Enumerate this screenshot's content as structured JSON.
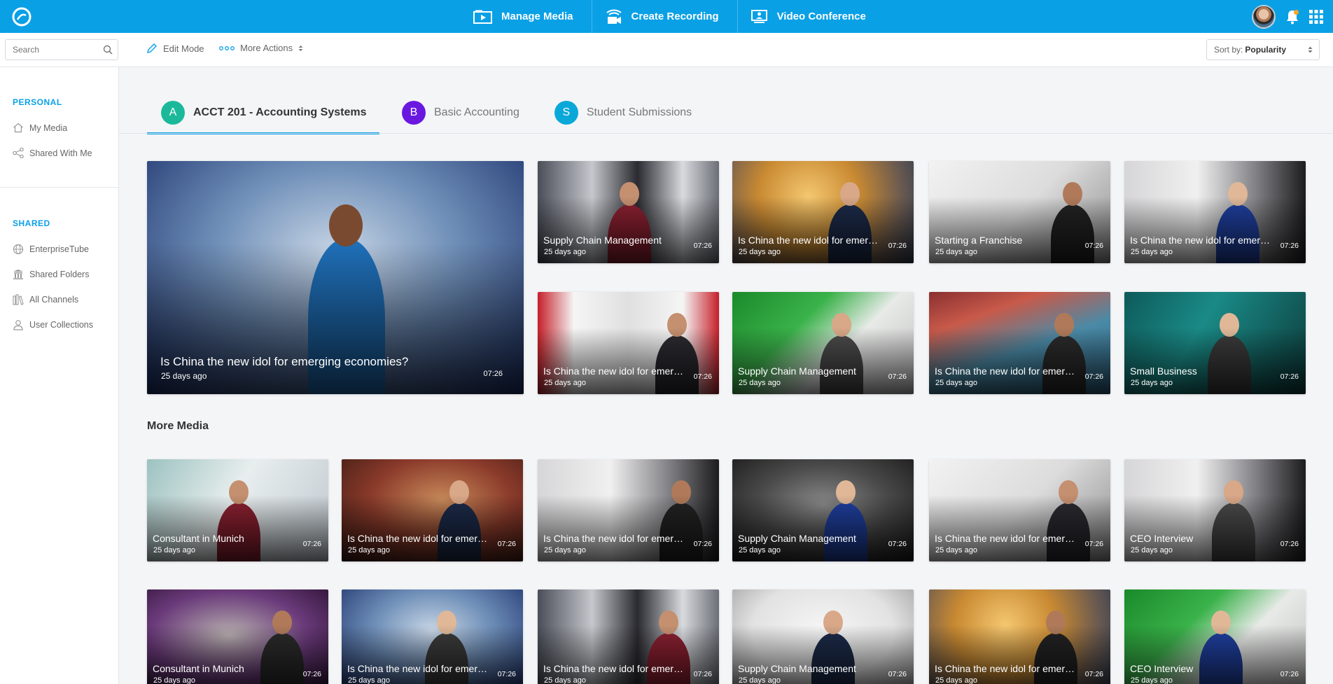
{
  "topbar": {
    "nav": [
      {
        "label": "Manage Media",
        "icon": "manage-media-icon"
      },
      {
        "label": "Create Recording",
        "icon": "create-recording-icon"
      },
      {
        "label": "Video Conference",
        "icon": "video-conference-icon"
      }
    ]
  },
  "toolbar": {
    "search_placeholder": "Search",
    "edit_mode": "Edit Mode",
    "more_actions": "More Actions",
    "sort_prefix": "Sort by:",
    "sort_value": "Popularity"
  },
  "sidebar": {
    "personal_head": "PERSONAL",
    "personal_items": [
      "My Media",
      "Shared With Me"
    ],
    "shared_head": "SHARED",
    "shared_items": [
      "EnterpriseTube",
      "Shared Folders",
      "All Channels",
      "User Collections"
    ]
  },
  "tabs": [
    {
      "letter": "A",
      "label": "ACCT 201 - Accounting Systems",
      "color": "#1bb99a",
      "active": true
    },
    {
      "letter": "B",
      "label": "Basic Accounting",
      "color": "#6a18e0",
      "active": false
    },
    {
      "letter": "S",
      "label": "Student Submissions",
      "color": "#0aa8d8",
      "active": false
    }
  ],
  "featured": {
    "title": "Is China the new idol for emerging economies?",
    "age": "25 days ago",
    "duration": "07:26"
  },
  "top_grid": [
    {
      "title": "Supply Chain Management",
      "age": "25 days ago",
      "duration": "07:26"
    },
    {
      "title": "Is China the new idol for emerg...",
      "age": "25 days ago",
      "duration": "07:26"
    },
    {
      "title": "Starting a Franchise",
      "age": "25 days ago",
      "duration": "07:26"
    },
    {
      "title": "Is China the new idol for emerg...",
      "age": "25 days ago",
      "duration": "07:26"
    },
    {
      "title": "Is China the new idol for emerg...",
      "age": "25 days ago",
      "duration": "07:26"
    },
    {
      "title": "Supply Chain Management",
      "age": "25 days ago",
      "duration": "07:26"
    },
    {
      "title": "Is China the new idol for emerg...",
      "age": "25 days ago",
      "duration": "07:26"
    },
    {
      "title": "Small Business",
      "age": "25 days ago",
      "duration": "07:26"
    }
  ],
  "more_media_title": "More Media",
  "more_media": [
    {
      "title": "Consultant in Munich",
      "age": "25 days ago",
      "duration": "07:26"
    },
    {
      "title": "Is China the new idol for emerg...",
      "age": "25 days ago",
      "duration": "07:26"
    },
    {
      "title": "Is China the new idol for emerg...",
      "age": "25 days ago",
      "duration": "07:26"
    },
    {
      "title": "Supply Chain Management",
      "age": "25 days ago",
      "duration": "07:26"
    },
    {
      "title": "Is China the new idol for emerg...",
      "age": "25 days ago",
      "duration": "07:26"
    },
    {
      "title": "CEO Interview",
      "age": "25 days ago",
      "duration": "07:26"
    },
    {
      "title": "Consultant in Munich",
      "age": "25 days ago",
      "duration": "07:26"
    },
    {
      "title": "Is China the new idol for emerg...",
      "age": "25 days ago",
      "duration": "07:26"
    },
    {
      "title": "Is China the new idol for emerg...",
      "age": "25 days ago",
      "duration": "07:26"
    },
    {
      "title": "Supply Chain Management",
      "age": "25 days ago",
      "duration": "07:26"
    },
    {
      "title": "Is China the new idol for emerg...",
      "age": "25 days ago",
      "duration": "07:26"
    },
    {
      "title": "CEO Interview",
      "age": "25 days ago",
      "duration": "07:26"
    }
  ]
}
